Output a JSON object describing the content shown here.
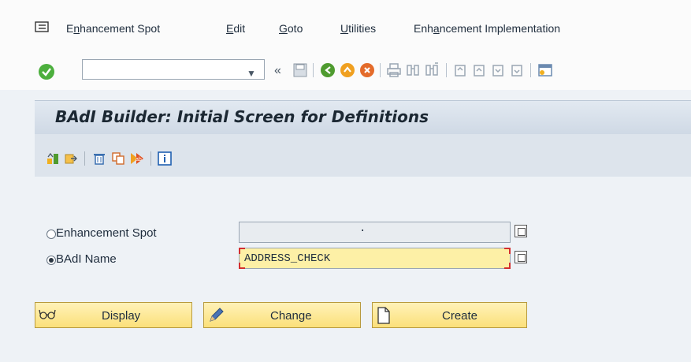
{
  "menu": {
    "items": [
      {
        "pre": "E",
        "u": "n",
        "post": "hancement Spot"
      },
      {
        "pre": "",
        "u": "E",
        "post": "dit"
      },
      {
        "pre": "",
        "u": "G",
        "post": "oto"
      },
      {
        "pre": "",
        "u": "U",
        "post": "tilities"
      },
      {
        "pre": "Enh",
        "u": "a",
        "post": "ncement Implementation"
      }
    ]
  },
  "toolbar": {
    "command_value": "",
    "dropdown_glyph": "▼",
    "back_glyph": "«"
  },
  "title": "BAdI Builder: Initial Screen for Definitions",
  "form": {
    "spot_label": "Enhancement Spot",
    "spot_value": "·",
    "badi_label": "BAdI Name",
    "badi_value": "ADDRESS_CHECK",
    "selected": "BAdI Name"
  },
  "buttons": {
    "display": "Display",
    "change": "Change",
    "create": "Create"
  },
  "colors": {
    "accent_yellow": "#fbe07a",
    "input_active": "#fdf0a6",
    "title_bg": "#cfd9e5"
  }
}
